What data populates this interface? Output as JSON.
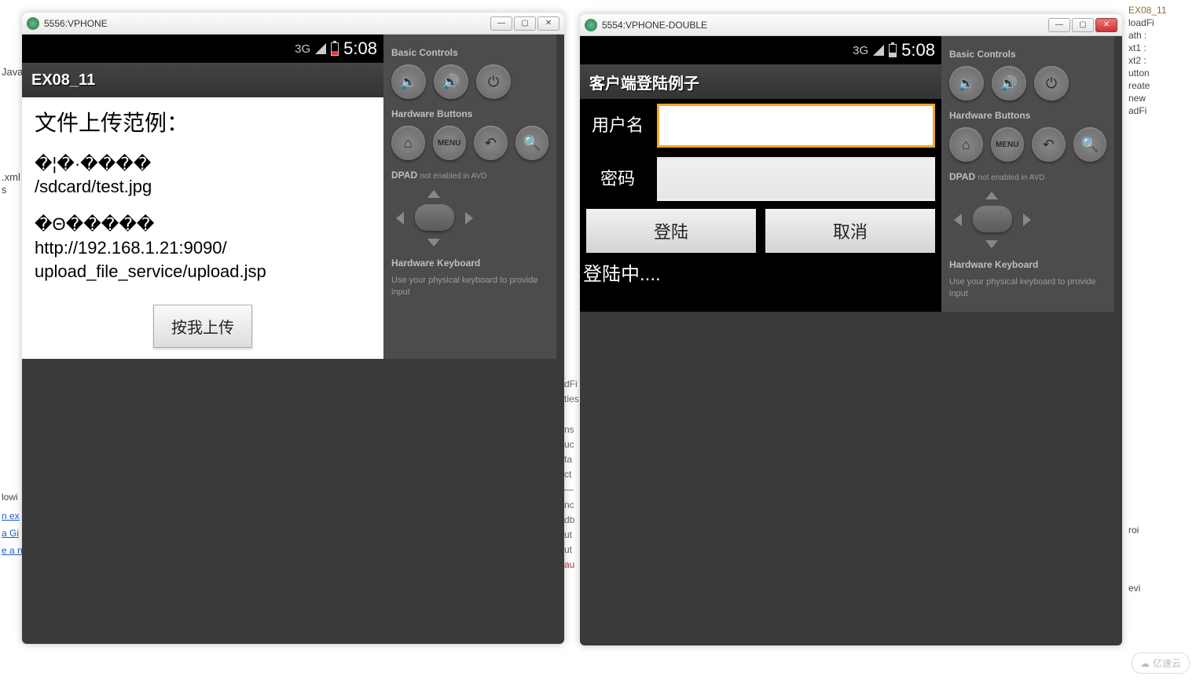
{
  "background": {
    "left_links": [
      "lowi",
      "n ex",
      "a Gi",
      "e a n"
    ],
    "left_texts": [
      "Java",
      ".xml",
      "s"
    ],
    "mid_code_lines": [
      "ns",
      "uc",
      "ta",
      "ct",
      "—",
      "nc",
      "db",
      "ut",
      "ut",
      "au"
    ],
    "mid_top_word": "dFi",
    "mid_word2": "ties"
  },
  "emu1": {
    "title": "5556:VPHONE",
    "window_buttons": {
      "min": "—",
      "max": "▢",
      "close": "✕"
    },
    "status": {
      "network": "3G",
      "time": "5:08"
    },
    "actionbar": "EX08_11",
    "content": {
      "heading": "文件上传范例：",
      "line1": "�¦�·����",
      "line2": "/sdcard/test.jpg",
      "line3": "�Θ�����",
      "line4": "http://192.168.1.21:9090/",
      "line5": "upload_file_service/upload.jsp",
      "button": "按我上传"
    },
    "panel": {
      "basic": "Basic Controls",
      "hardware": "Hardware Buttons",
      "menu_label": "MENU",
      "dpad": "DPAD",
      "dpad_note": "not enabled in AVD",
      "keyboard": "Hardware Keyboard",
      "keyboard_note": "Use your physical keyboard to provide input"
    }
  },
  "emu2": {
    "title": "5554:VPHONE-DOUBLE",
    "window_buttons": {
      "min": "—",
      "max": "▢",
      "close": "✕"
    },
    "status": {
      "network": "3G",
      "time": "5:08"
    },
    "actionbar": "客户端登陆例子",
    "form": {
      "username_label": "用户名",
      "password_label": "密码",
      "login_btn": "登陆",
      "cancel_btn": "取消",
      "status_text": "登陆中...."
    },
    "panel": {
      "basic": "Basic Controls",
      "hardware": "Hardware Buttons",
      "menu_label": "MENU",
      "dpad": "DPAD",
      "dpad_note": "not enabled in AVD",
      "keyboard": "Hardware Keyboard",
      "keyboard_note": "Use your physical keyboard to provide input"
    }
  },
  "ide": {
    "lines": [
      "EX08_11",
      "loadFi",
      "ath :",
      "xt1 :",
      "xt2 :",
      "utton",
      "reate",
      "new",
      "adFi",
      "roi",
      "evi"
    ]
  },
  "watermark": "亿速云"
}
